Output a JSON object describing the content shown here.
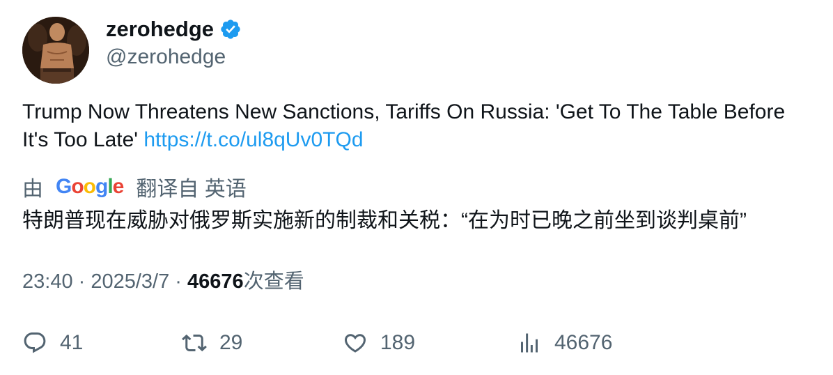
{
  "author": {
    "display_name": "zerohedge",
    "handle": "@zerohedge",
    "verified": true,
    "verified_icon": "verified-badge-icon",
    "verified_color": "#1d9bf0"
  },
  "tweet": {
    "text": "Trump Now Threatens New Sanctions, Tariffs On Russia: 'Get To The Table Before It's Too Late' ",
    "link_text": "https://t.co/ul8qUv0TQd",
    "link_color": "#1d9bf0"
  },
  "translation": {
    "by_label": "由",
    "provider_letters": [
      "G",
      "o",
      "o",
      "g",
      "l",
      "e"
    ],
    "from_label": "翻译自 英语",
    "translated_text": "特朗普现在威胁对俄罗斯实施新的制裁和关税：“在为时已晚之前坐到谈判桌前”"
  },
  "meta": {
    "time": "23:40",
    "separator": " · ",
    "date": "2025/3/7",
    "views_count": "46676",
    "views_label": "次查看"
  },
  "actions": {
    "replies": "41",
    "retweets": "29",
    "likes": "189",
    "views": "46676",
    "icon_color": "#536471"
  }
}
